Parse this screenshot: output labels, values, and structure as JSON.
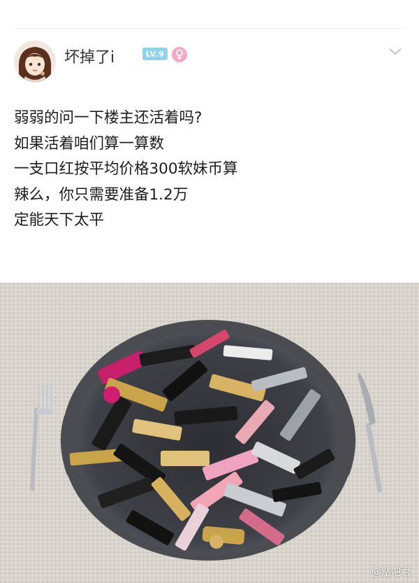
{
  "post": {
    "username": "坏掉了i",
    "level_badge": "LV.9",
    "gender_icon": "female-symbol-icon",
    "menu_icon": "chevron-down-icon",
    "lines": [
      "弱弱的问一下楼主还活着吗?",
      "如果活着咱们算一算数",
      "一支口红按平均价格300软妹币算",
      "辣么，你只需要准备1.2万",
      "定能天下太平"
    ]
  },
  "photo": {
    "watermark": "@贴吧君"
  },
  "colors": {
    "level_badge": "#8fd2ee",
    "gender_badge": "#f6a7c1",
    "text": "#1d1d1d",
    "carpet": "#d9d4cd"
  }
}
